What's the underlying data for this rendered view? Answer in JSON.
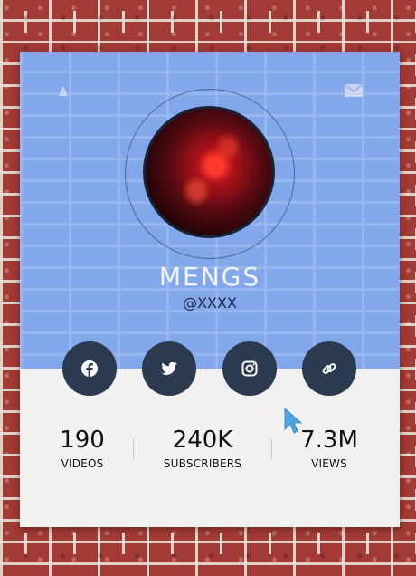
{
  "profile": {
    "name": "MENGS",
    "handle": "@XXXX"
  },
  "icons": {
    "notification": "bell-icon",
    "message": "mail-icon",
    "cursor": "mouse-pointer"
  },
  "social": [
    {
      "network": "facebook",
      "icon": "facebook-icon"
    },
    {
      "network": "twitter",
      "icon": "twitter-icon"
    },
    {
      "network": "instagram",
      "icon": "instagram-icon"
    },
    {
      "network": "website",
      "icon": "link-icon"
    }
  ],
  "stats": [
    {
      "value": "190",
      "label": "VIDEOS"
    },
    {
      "value": "240K",
      "label": "SUBSCRIBERS"
    },
    {
      "value": "7.3M",
      "label": "VIEWS"
    }
  ],
  "colors": {
    "header_overlay": "#8fb0ea",
    "card_body": "#f2f1f0",
    "social_button": "#2b3a4f",
    "name_text": "#f3f5fb",
    "cursor": "#4da3e0"
  }
}
